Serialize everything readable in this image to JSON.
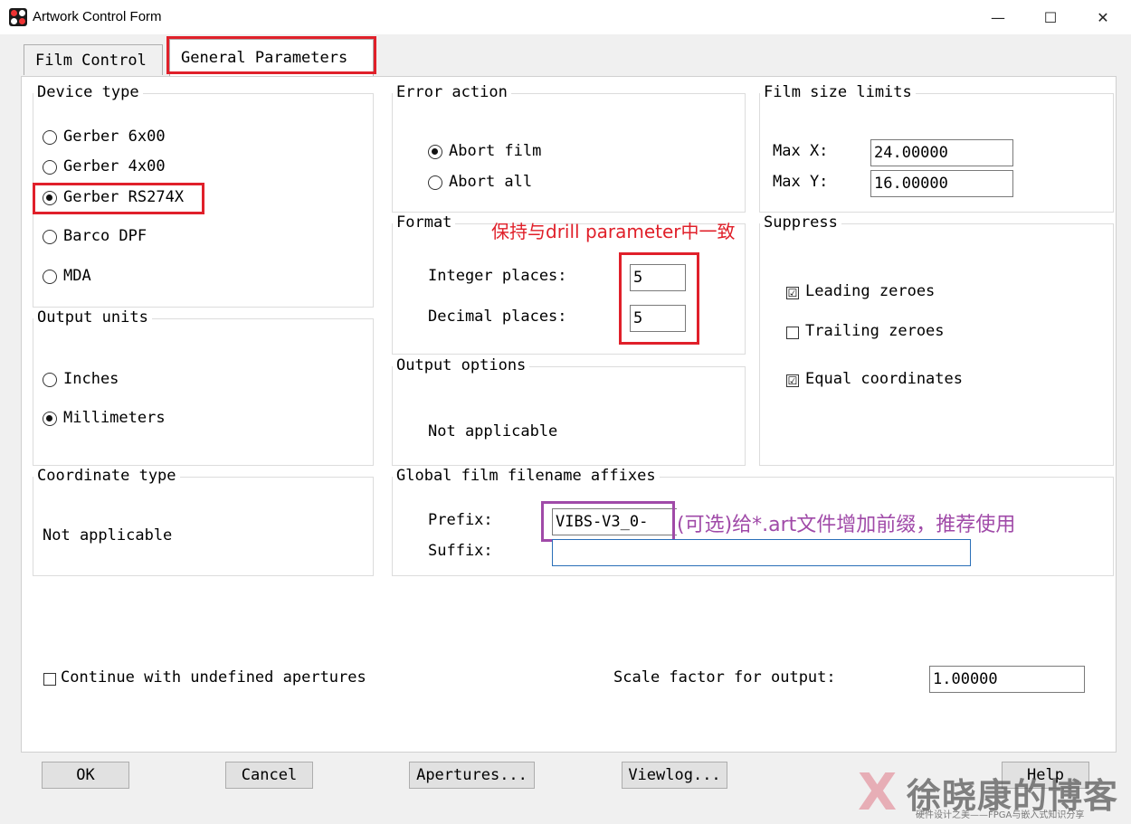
{
  "window": {
    "title": "Artwork Control Form",
    "minimize": "—",
    "maximize": "☐",
    "close": "✕"
  },
  "tabs": [
    {
      "label": "Film Control"
    },
    {
      "label": "General Parameters"
    }
  ],
  "device_type": {
    "legend": "Device type",
    "options": [
      "Gerber 6x00",
      "Gerber 4x00",
      "Gerber RS274X",
      "Barco DPF",
      "MDA"
    ],
    "selected": "Gerber RS274X"
  },
  "error_action": {
    "legend": "Error action",
    "options": [
      "Abort film",
      "Abort all"
    ],
    "selected": "Abort film"
  },
  "film_size": {
    "legend": "Film size limits",
    "max_x_label": "Max X:",
    "max_x": "24.00000",
    "max_y_label": "Max Y:",
    "max_y": "16.00000"
  },
  "format": {
    "legend": "Format",
    "integer_label": "Integer places:",
    "integer_value": "5",
    "decimal_label": "Decimal places:",
    "decimal_value": "5",
    "annotation": "保持与drill parameter中一致"
  },
  "suppress": {
    "legend": "Suppress",
    "items": [
      {
        "label": "Leading zeroes",
        "checked": true,
        "mark": "☑"
      },
      {
        "label": "Trailing zeroes",
        "checked": false,
        "mark": ""
      },
      {
        "label": "Equal coordinates",
        "checked": true,
        "mark": "☑"
      }
    ]
  },
  "output_units": {
    "legend": "Output units",
    "options": [
      "Inches",
      "Millimeters"
    ],
    "selected": "Millimeters"
  },
  "output_options": {
    "legend": "Output options",
    "text": "Not applicable"
  },
  "coordinate_type": {
    "legend": "Coordinate type",
    "text": "Not applicable"
  },
  "affixes": {
    "legend": "Global film filename affixes",
    "prefix_label": "Prefix:",
    "prefix_value": "VIBS-V3_0-",
    "suffix_label": "Suffix:",
    "suffix_value": "",
    "annotation": "(可选)给*.art文件增加前缀，推荐使用"
  },
  "continue_undefined": {
    "label": "Continue with undefined apertures",
    "checked": false
  },
  "scale": {
    "label": "Scale factor for output:",
    "value": "1.00000"
  },
  "buttons": {
    "ok": "OK",
    "cancel": "Cancel",
    "apertures": "Apertures...",
    "viewlog": "Viewlog...",
    "help": "Help"
  },
  "watermark": {
    "name": "徐晓康的博客",
    "tagline": "硬件设计之美——FPGA与嵌入式知识分享"
  },
  "colors": {
    "highlight_red": "#e0202a",
    "highlight_purple": "#a04aa8",
    "suffix_border": "#2a6fb8"
  }
}
